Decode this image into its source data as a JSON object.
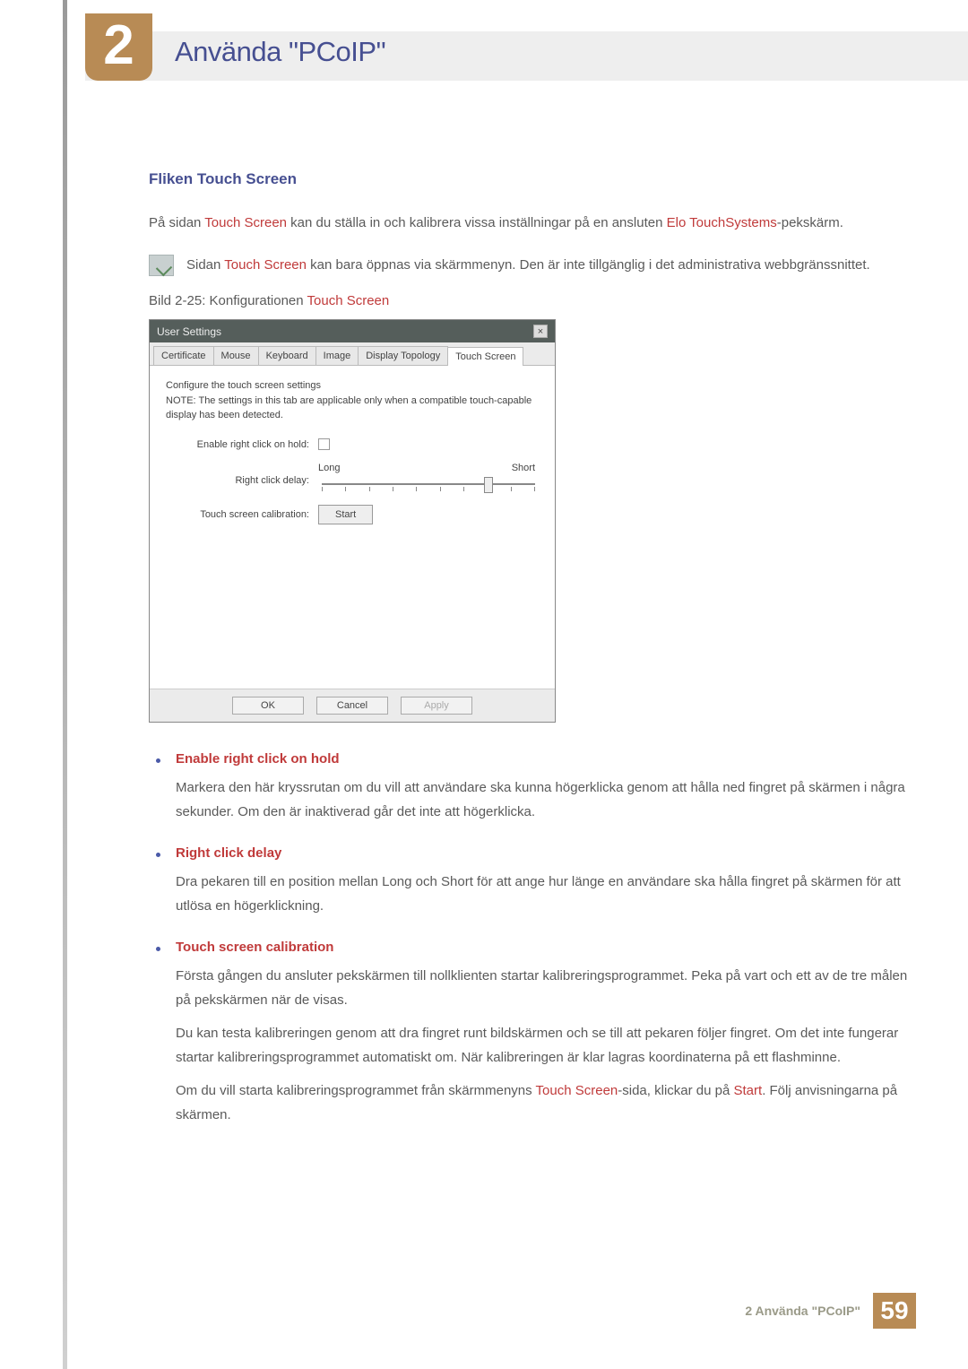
{
  "header": {
    "chapter_number": "2",
    "chapter_title": "Använda \"PCoIP\""
  },
  "section": {
    "heading": "Fliken Touch Screen",
    "intro_1_pre": "På sidan ",
    "intro_1_hl1": "Touch Screen",
    "intro_1_mid": " kan du ställa in och kalibrera vissa inställningar på en ansluten ",
    "intro_1_hl2": "Elo TouchSystems",
    "intro_1_post": "-pekskärm.",
    "note_pre": "Sidan ",
    "note_hl": "Touch Screen",
    "note_post": " kan bara öppnas via skärmmenyn. Den är inte tillgänglig i det administrativa webbgränssnittet.",
    "caption_pre": "Bild 2-25: Konfigurationen ",
    "caption_hl": "Touch Screen"
  },
  "dialog": {
    "title": "User Settings",
    "close": "×",
    "tabs": [
      "Certificate",
      "Mouse",
      "Keyboard",
      "Image",
      "Display Topology",
      "Touch Screen"
    ],
    "active_tab_index": 5,
    "desc_line1": "Configure the touch screen settings",
    "desc_line2": "NOTE: The settings in this tab are applicable only when a compatible touch-capable display has been detected.",
    "rows": {
      "enable_label": "Enable right click on hold:",
      "delay_label": "Right click delay:",
      "delay_long": "Long",
      "delay_short": "Short",
      "calib_label": "Touch screen calibration:",
      "start_btn": "Start"
    },
    "buttons": {
      "ok": "OK",
      "cancel": "Cancel",
      "apply": "Apply"
    }
  },
  "bullets": [
    {
      "title": "Enable right click on hold",
      "paras": [
        "Markera den här kryssrutan om du vill att användare ska kunna högerklicka genom att hålla ned fingret på skärmen i några sekunder. Om den är inaktiverad går det inte att högerklicka."
      ]
    },
    {
      "title": "Right click delay",
      "paras": [
        "Dra pekaren till en position mellan Long och Short för att ange hur länge en användare ska hålla fingret på skärmen för att utlösa en högerklickning."
      ]
    },
    {
      "title": "Touch screen calibration",
      "paras": [
        "Första gången du ansluter pekskärmen till nollklienten startar kalibreringsprogrammet. Peka på vart och ett av de tre målen på pekskärmen när de visas.",
        "Du kan testa kalibreringen genom att dra fingret runt bildskärmen och se till att pekaren följer fingret. Om det inte fungerar startar kalibreringsprogrammet automatiskt om. När kalibreringen är klar lagras koordinaterna på ett flashminne."
      ],
      "final_pre": "Om du vill starta kalibreringsprogrammet från skärmmenyns ",
      "final_hl1": "Touch Screen",
      "final_mid": "-sida, klickar du på ",
      "final_hl2": "Start",
      "final_post": ". Följ anvisningarna på skärmen."
    }
  ],
  "footer": {
    "text": "2 Använda \"PCoIP\"",
    "page": "59"
  }
}
